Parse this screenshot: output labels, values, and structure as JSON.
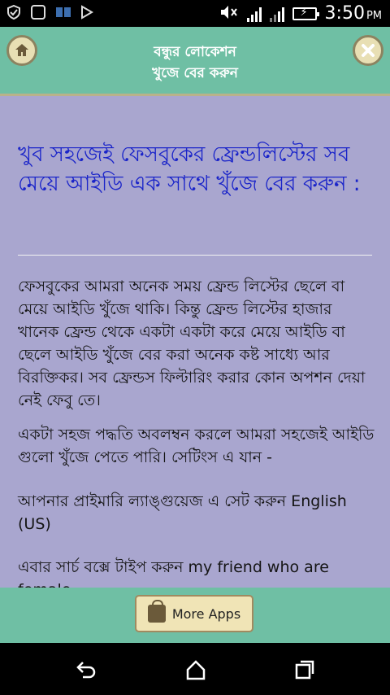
{
  "status_bar": {
    "time": "3:50",
    "ampm": "PM",
    "icons": [
      "shield-check-icon",
      "keyboard-icon",
      "book-icon",
      "cast-icon",
      "mute-icon",
      "signal-icon",
      "signal-icon",
      "battery-charging-icon"
    ]
  },
  "header": {
    "title_line1": "বন্ধুর লোকেশন",
    "title_line2": "খুজে বের করুন",
    "home_icon": "home-icon",
    "close_icon": "close-icon",
    "accent": "#6fbfa4"
  },
  "article": {
    "headline": "খুব সহজেই ফেসবুকের ফ্রেন্ডলিস্টের সব মেয়ে আইডি এক সাথে খুঁজে বের করুন :",
    "paragraphs": [
      "ফেসবুকের আমরা অনেক সময় ফ্রেন্ড লিস্টের ছেলে বা মেয়ে আইডি খুঁজে থাকি। কিন্তু ফ্রেন্ড লিস্টের হাজার খানেক ফ্রেন্ড থেকে একটা একটা করে মেয়ে আইডি বা ছেলে আইডি খুঁজে বের করা অনেক কষ্ট সাধ্যে আর বিরক্তিকর। সব ফ্রেন্ডস ফিল্টারিং করার কোন অপশন দেয়া নেই ফেবু তে।",
      "একটা সহজ পদ্ধতি অবলম্বন করলে আমরা সহজেই আইডি গুলো খুঁজে পেতে পারি। সেটিংস এ যান -",
      "আপনার প্রাইমারি ল্যাঙ্গুয়েজ এ সেট করুন English (US)",
      "এবার সার্চ বক্সে টাইপ করুন my friend who are female"
    ],
    "headline_color": "#1a24c9",
    "background": "#a9a6cf"
  },
  "footer": {
    "more_apps_label": "More Apps",
    "more_apps_icon": "shopping-bag-icon"
  },
  "nav_bar": {
    "icons": [
      "back-icon",
      "home-icon",
      "recent-apps-icon"
    ]
  }
}
